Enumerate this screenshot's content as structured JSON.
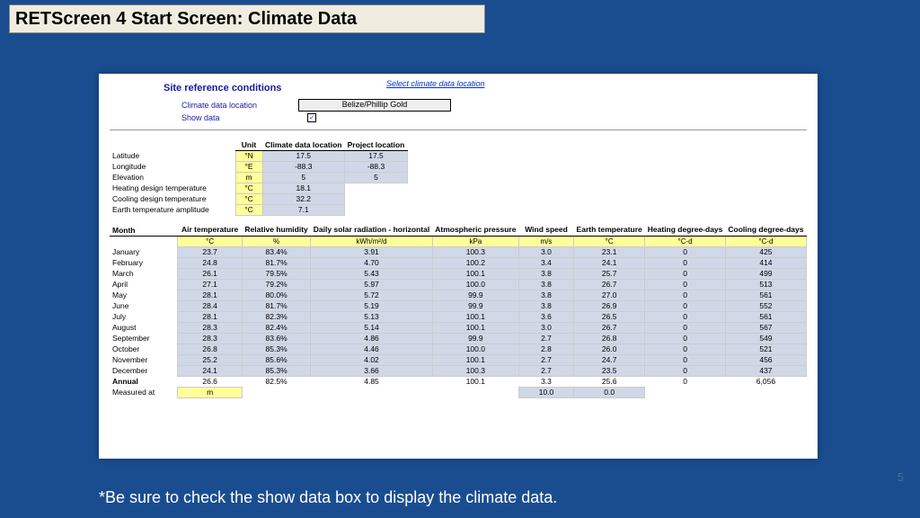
{
  "slide": {
    "title": "RETScreen 4 Start Screen: Climate Data",
    "footnote": "*Be sure to check the show data box to display the climate data.",
    "pageNumber": "5"
  },
  "panel": {
    "siteRef": "Site reference conditions",
    "link": "Select climate data location",
    "locLabel": "Climate data location",
    "locValue": "Belize/Phillip Gold",
    "showDataLabel": "Show data",
    "showDataChecked": "✓"
  },
  "params": {
    "headers": {
      "unit": "Unit",
      "c1": "Climate data location",
      "c2": "Project location"
    },
    "rows": [
      {
        "label": "Latitude",
        "unit": "°N",
        "v1": "17.5",
        "v2": "17.5"
      },
      {
        "label": "Longitude",
        "unit": "°E",
        "v1": "-88.3",
        "v2": "-88.3"
      },
      {
        "label": "Elevation",
        "unit": "m",
        "v1": "5",
        "v2": "5"
      },
      {
        "label": "Heating design temperature",
        "unit": "°C",
        "v1": "18.1",
        "v2": ""
      },
      {
        "label": "Cooling design temperature",
        "unit": "°C",
        "v1": "32.2",
        "v2": ""
      },
      {
        "label": "Earth temperature amplitude",
        "unit": "°C",
        "v1": "7.1",
        "v2": ""
      }
    ]
  },
  "monthly": {
    "cols": [
      "Month",
      "Air temperature",
      "Relative humidity",
      "Daily solar radiation - horizontal",
      "Atmospheric pressure",
      "Wind speed",
      "Earth temperature",
      "Heating degree-days",
      "Cooling degree-days"
    ],
    "units": [
      "",
      "°C",
      "%",
      "kWh/m²/d",
      "kPa",
      "m/s",
      "°C",
      "°C-d",
      "°C-d"
    ],
    "rows": [
      [
        "January",
        "23.7",
        "83.4%",
        "3.91",
        "100.3",
        "3.0",
        "23.1",
        "0",
        "425"
      ],
      [
        "February",
        "24.8",
        "81.7%",
        "4.70",
        "100.2",
        "3.4",
        "24.1",
        "0",
        "414"
      ],
      [
        "March",
        "26.1",
        "79.5%",
        "5.43",
        "100.1",
        "3.8",
        "25.7",
        "0",
        "499"
      ],
      [
        "April",
        "27.1",
        "79.2%",
        "5.97",
        "100.0",
        "3.8",
        "26.7",
        "0",
        "513"
      ],
      [
        "May",
        "28.1",
        "80.0%",
        "5.72",
        "99.9",
        "3.8",
        "27.0",
        "0",
        "561"
      ],
      [
        "June",
        "28.4",
        "81.7%",
        "5.19",
        "99.9",
        "3.8",
        "26.9",
        "0",
        "552"
      ],
      [
        "July",
        "28.1",
        "82.3%",
        "5.13",
        "100.1",
        "3.6",
        "26.5",
        "0",
        "561"
      ],
      [
        "August",
        "28.3",
        "82.4%",
        "5.14",
        "100.1",
        "3.0",
        "26.7",
        "0",
        "567"
      ],
      [
        "September",
        "28.3",
        "83.6%",
        "4.86",
        "99.9",
        "2.7",
        "26.8",
        "0",
        "549"
      ],
      [
        "October",
        "26.8",
        "85.3%",
        "4.46",
        "100.0",
        "2.8",
        "26.0",
        "0",
        "521"
      ],
      [
        "November",
        "25.2",
        "85.6%",
        "4.02",
        "100.1",
        "2.7",
        "24.7",
        "0",
        "456"
      ],
      [
        "December",
        "24.1",
        "85.3%",
        "3.66",
        "100.3",
        "2.7",
        "23.5",
        "0",
        "437"
      ]
    ],
    "annual": [
      "Annual",
      "26.6",
      "82.5%",
      "4.85",
      "100.1",
      "3.3",
      "25.6",
      "0",
      "6,056"
    ],
    "measuredAt": "Measured at",
    "measuredUnit": "m",
    "measuredVals": [
      "10.0",
      "0.0"
    ]
  }
}
